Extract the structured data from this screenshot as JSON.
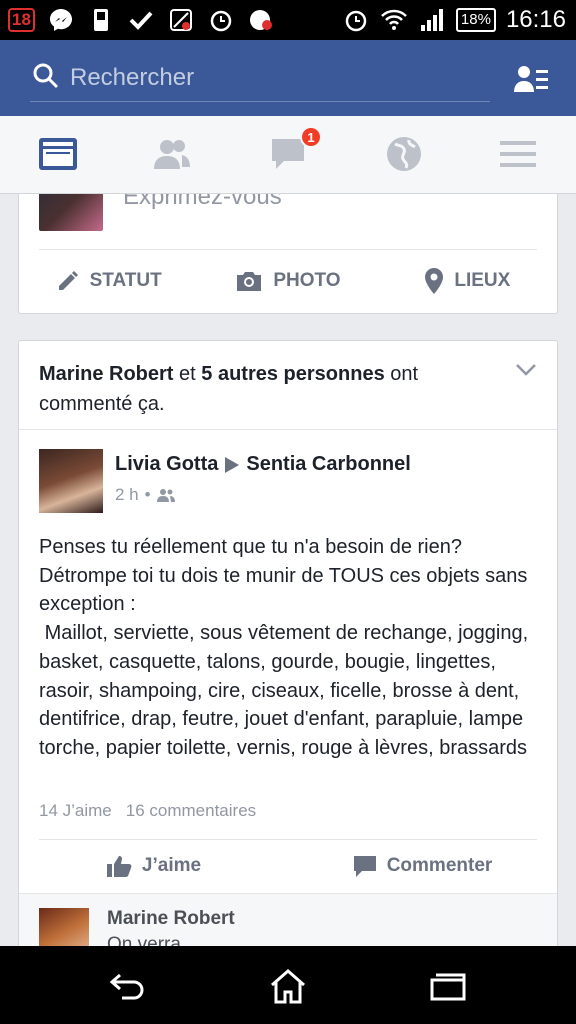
{
  "status_bar": {
    "badge": "18",
    "battery": "18%",
    "time": "16:16"
  },
  "search": {
    "placeholder": "Rechercher"
  },
  "tabs": {
    "notifications_count": "1"
  },
  "composer": {
    "prompt": "Exprimez-vous",
    "actions": [
      "STATUT",
      "PHOTO",
      "LIEUX"
    ]
  },
  "post": {
    "social": {
      "name": "Marine Robert",
      "connector": "et",
      "others": "5 autres personnes",
      "tail": "ont commenté ça."
    },
    "author": "Livia Gotta",
    "target": "Sentia Carbonnel",
    "time": "2 h",
    "body": "Penses tu réellement que tu n'a besoin de rien?\nDétrompe toi tu dois te munir de TOUS ces objets sans exception :\n Maillot, serviette, sous vêtement de rechange, jogging, basket, casquette, talons, gourde, bougie, lingettes, rasoir, shampoing, cire, ciseaux, ficelle, brosse à dent, dentifrice, drap, feutre, jouet d'enfant, parapluie, lampe torche, papier toilette, vernis, rouge à lèvres, brassards",
    "likes": "14 J’aime",
    "comments": "16 commentaires",
    "like_label": "J’aime",
    "comment_label": "Commenter"
  },
  "comment": {
    "name": "Marine Robert",
    "text": "On verra ..."
  },
  "colors": {
    "brand": "#3b5998",
    "badge": "#f03d25"
  }
}
